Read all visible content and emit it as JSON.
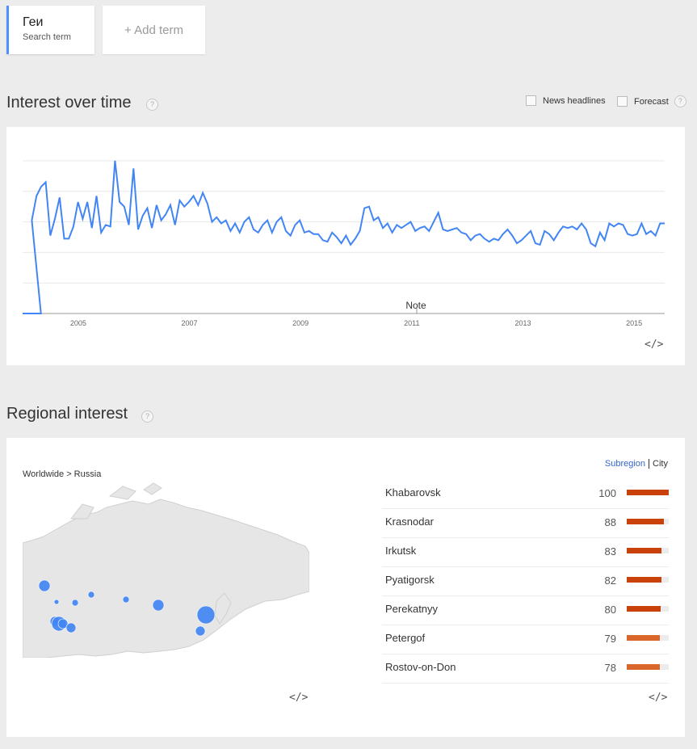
{
  "term": {
    "name": "Геи",
    "subtitle": "Search term"
  },
  "add_term": "+ Add term",
  "interest": {
    "title": "Interest over time",
    "help": "?",
    "options": [
      "News headlines",
      "Forecast"
    ]
  },
  "chart_data": {
    "type": "line",
    "x": [
      2004.0,
      2004.33,
      2004.42,
      2004.5,
      2004.6,
      2004.67,
      2004.75,
      2005.05,
      2005.12,
      2005.2,
      2005.3,
      2005.37,
      2005.45,
      2005.52,
      2005.6,
      2005.67,
      2005.75,
      2005.82,
      2005.9,
      2005.98,
      2006.05,
      2006.12,
      2006.22,
      2006.3,
      2006.37,
      2006.45,
      2006.52,
      2006.6,
      2006.68,
      2006.75,
      2006.82,
      2006.92,
      2007.0,
      2007.05,
      2007.12,
      2007.2,
      2007.3,
      2007.37,
      2007.45,
      2007.52,
      2007.62,
      2007.75,
      2007.9,
      2008.0,
      2008.12,
      2008.2,
      2008.3,
      2008.4,
      2008.5,
      2008.6,
      2008.7,
      2008.8,
      2008.9,
      2009.0,
      2009.07,
      2009.15,
      2009.25,
      2009.35,
      2009.45,
      2009.6,
      2009.7,
      2009.8,
      2009.9,
      2010.0,
      2010.1,
      2010.2,
      2010.3,
      2010.4,
      2010.5,
      2010.6,
      2010.72,
      2010.8,
      2010.88,
      2010.95,
      2011.05,
      2011.15,
      2011.25,
      2011.35,
      2011.45,
      2011.55,
      2011.65,
      2011.75,
      2011.85,
      2011.95,
      2012.1,
      2012.25,
      2012.4,
      2012.55,
      2012.7,
      2012.85,
      2012.95,
      2013.05,
      2013.15,
      2013.25,
      2013.35,
      2013.45,
      2013.55,
      2013.7,
      2013.8,
      2013.9,
      2014.0,
      2014.1,
      2014.2,
      2014.3,
      2014.4,
      2014.5,
      2014.6,
      2014.7,
      2014.8,
      2014.9,
      2015.0,
      2015.05,
      2015.15,
      2015.25,
      2015.35,
      2015.45,
      2015.55
    ],
    "y": [
      0,
      0,
      61,
      77,
      83,
      86,
      51,
      62,
      76,
      49,
      49,
      57,
      73,
      62,
      73,
      56,
      77,
      53,
      58,
      57,
      100,
      73,
      70,
      58,
      95,
      55,
      64,
      69,
      56,
      71,
      61,
      65,
      71,
      58,
      74,
      70,
      73,
      77,
      71,
      79,
      72,
      60,
      63,
      59,
      61,
      54,
      59,
      53,
      60,
      63,
      55,
      53,
      58,
      61,
      53,
      60,
      63,
      54,
      51,
      58,
      61,
      53,
      54,
      52,
      52,
      48,
      47,
      53,
      50,
      46,
      51,
      45,
      49,
      54,
      69,
      70,
      61,
      63,
      56,
      59,
      53,
      58,
      56,
      58,
      60,
      54,
      56,
      57,
      54,
      60,
      66,
      55,
      54,
      55,
      56,
      53,
      52,
      48,
      51,
      52,
      49,
      47,
      49,
      48,
      52,
      55,
      51,
      46,
      48,
      51,
      54,
      46,
      45,
      54,
      52,
      48,
      53,
      57,
      56,
      57,
      55,
      59,
      55,
      46,
      44,
      53,
      48,
      59,
      57,
      59,
      58,
      52,
      51,
      52,
      59,
      52,
      54,
      51,
      59,
      59
    ],
    "x_ticks": [
      "2005",
      "2007",
      "2009",
      "2011",
      "2013",
      "2015"
    ],
    "xlim": [
      2004.0,
      2015.55
    ],
    "ylim": [
      0,
      100
    ],
    "annotation": "Note",
    "color": "#4285f4",
    "grid": true
  },
  "regional": {
    "title": "Regional interest",
    "help": "?",
    "breadcrumb": "Worldwide > Russia",
    "toggle_subregion": "Subregion",
    "toggle_city": "City",
    "rows": [
      {
        "name": "Khabarovsk",
        "value": 100,
        "color": "#c9420b"
      },
      {
        "name": "Krasnodar",
        "value": 88,
        "color": "#c9420b"
      },
      {
        "name": "Irkutsk",
        "value": 83,
        "color": "#c9420b"
      },
      {
        "name": "Pyatigorsk",
        "value": 82,
        "color": "#c9420b"
      },
      {
        "name": "Perekatnyy",
        "value": 80,
        "color": "#c9420b"
      },
      {
        "name": "Petergof",
        "value": 79,
        "color": "#d9662b"
      },
      {
        "name": "Rostov-on-Don",
        "value": 78,
        "color": "#d9662b"
      }
    ],
    "bubble_color": "#4285f4"
  },
  "embed": "</>"
}
